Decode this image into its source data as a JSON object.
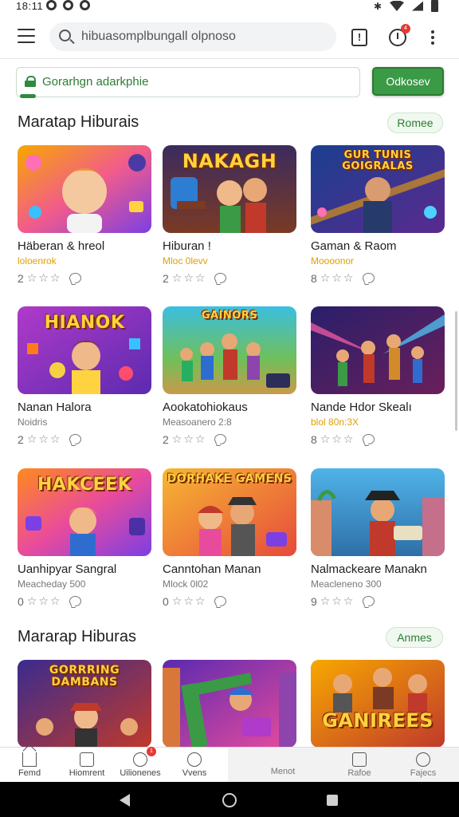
{
  "status_bar": {
    "time": "18:11",
    "bluetooth_icon": "bluetooth-icon"
  },
  "top_bar": {
    "menu_icon": "hamburger-menu-icon",
    "search": {
      "placeholder": "hibuasomplbungall olpnoso"
    },
    "report_icon": "report-icon",
    "report_glyph": "!",
    "alarm_icon": "alarm-clock-icon",
    "alarm_badge": "4",
    "overflow_icon": "more-vertical-icon"
  },
  "banner": {
    "text": "Gorarhgn adarkphie",
    "button_label": "Odkosev"
  },
  "sections": [
    {
      "title": "Maratap Hiburais",
      "action_label": "Romee",
      "cards": [
        {
          "title": "Häberan & hreol",
          "subtitle": "loloenrok",
          "subtitle_style": "orange",
          "rating": "2",
          "thumb_text": ""
        },
        {
          "title": "Hiburan !",
          "subtitle": "Mloc 0levv",
          "subtitle_style": "orange",
          "rating": "2",
          "thumb_text": "NAKAGH"
        },
        {
          "title": "Gaman & Raom",
          "subtitle": "Moooonor",
          "subtitle_style": "orange",
          "rating": "8",
          "thumb_text": "GUR TUNIS GOIGRALAS"
        },
        {
          "title": "Nanan Halora",
          "subtitle": "Noidris",
          "subtitle_style": "gray",
          "rating": "2",
          "thumb_text": "HIANOK"
        },
        {
          "title": "Aookatohiokaus",
          "subtitle": "Measoanero 2:8",
          "subtitle_style": "gray",
          "rating": "2",
          "thumb_text": "GAINORS"
        },
        {
          "title": "Nande Hdor Skealı",
          "subtitle": "blol 80n:3X",
          "subtitle_style": "orange",
          "rating": "8",
          "thumb_text": ""
        },
        {
          "title": "Uanhipyar Sangral",
          "subtitle": "Meacheday 500",
          "subtitle_style": "gray",
          "rating": "0",
          "thumb_text": "HAKCEEK"
        },
        {
          "title": "Canntohan Manan",
          "subtitle": "Mlock 0l02",
          "subtitle_style": "gray",
          "rating": "0",
          "thumb_text": "DORHAKE GAMENS"
        },
        {
          "title": "Nalmackeare Manakn",
          "subtitle": "Meacleneno 300",
          "subtitle_style": "gray",
          "rating": "9",
          "thumb_text": ""
        }
      ]
    },
    {
      "title": "Mararap Hiburas",
      "action_label": "Anmes",
      "cards": [
        {
          "thumb_text": "GORRRING DAMBANS"
        },
        {
          "thumb_text": ""
        },
        {
          "thumb_text": "GANIREES"
        }
      ]
    }
  ],
  "bottom_nav": {
    "items": [
      {
        "label": "Femd",
        "icon": "home-icon"
      },
      {
        "label": "Hiomrent",
        "icon": "media-icon"
      },
      {
        "label": "Uilionenes",
        "icon": "clock-icon"
      },
      {
        "label": "Vvens",
        "icon": "chat-icon"
      },
      {
        "label": "Menot",
        "icon": ""
      },
      {
        "label": "Rafoe",
        "icon": "inbox-icon"
      },
      {
        "label": "Fajecs",
        "icon": "profile-icon"
      }
    ],
    "badge": "1"
  },
  "system_nav": {
    "back_icon": "back-triangle-icon",
    "home_icon": "home-circle-icon",
    "recents_icon": "recents-square-icon"
  },
  "colors": {
    "accent_green": "#3a9a45",
    "badge_red": "#e53935",
    "rating_gray": "#888888"
  }
}
